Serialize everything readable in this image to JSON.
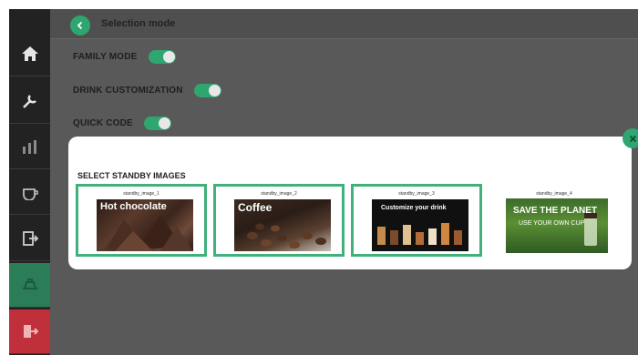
{
  "header": {
    "title": "Selection mode"
  },
  "settings": [
    {
      "label": "FAMILY MODE",
      "on": true
    },
    {
      "label": "DRINK CUSTOMIZATION",
      "on": true
    },
    {
      "label": "QUICK CODE",
      "on": true
    }
  ],
  "sidebar": {
    "items": [
      {
        "icon": "home-icon"
      },
      {
        "icon": "wrench-icon"
      },
      {
        "icon": "chart-icon"
      },
      {
        "icon": "coffee-cup-icon"
      },
      {
        "icon": "export-icon"
      },
      {
        "icon": "coffee-machine-icon",
        "active": true
      },
      {
        "icon": "exit-icon",
        "exit": true
      }
    ]
  },
  "modal": {
    "title": "SELECT STANDBY IMAGES",
    "images": [
      {
        "name": "standby_image_1",
        "overlay_text": "Hot chocolate",
        "selected": true
      },
      {
        "name": "standby_image_2",
        "overlay_text": "Coffee",
        "selected": true
      },
      {
        "name": "standby_image_3",
        "overlay_text": "Customize your drink",
        "selected": true
      },
      {
        "name": "standby_image_4",
        "overlay_text": "SAVE THE PLANET",
        "overlay_subtext": "USE YOUR OWN CUP",
        "selected": false
      }
    ]
  },
  "colors": {
    "accent": "#2fa56f",
    "exit": "#c0303a",
    "background": "#595959"
  }
}
